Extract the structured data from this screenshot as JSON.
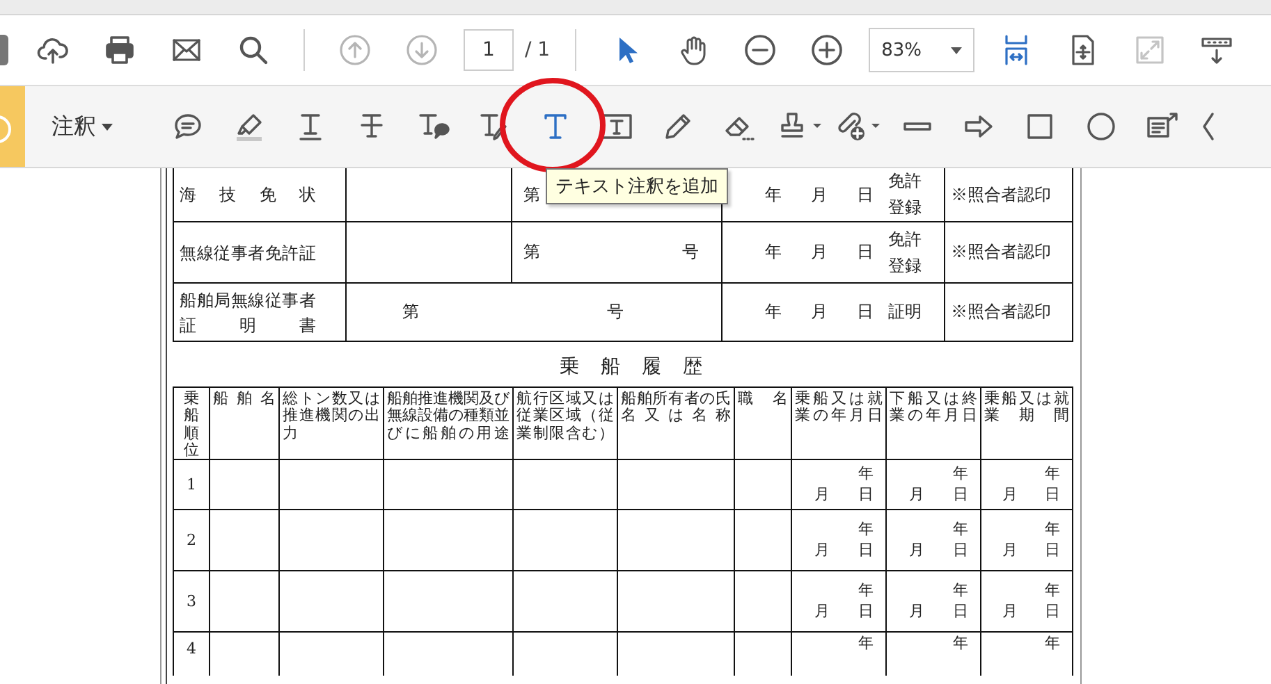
{
  "main_toolbar": {
    "nav_buttons": [
      {
        "disabled": true
      },
      {
        "disabled": true
      }
    ],
    "page_field": {
      "value": "1"
    },
    "page_total": "/ 1",
    "tools": [
      {
        "selected": true
      },
      {
        "selected": false
      }
    ],
    "zoom": {
      "value": "83%"
    },
    "view_buttons": [
      {
        "disabled": false
      },
      {
        "disabled": false
      },
      {
        "disabled": true
      },
      {
        "disabled": false
      }
    ]
  },
  "annotation_toolbar": {
    "label": "注釈",
    "tools": [
      {
        "selected": false
      },
      {
        "selected": false
      },
      {
        "selected": false
      },
      {
        "selected": false
      },
      {
        "selected": false
      },
      {
        "selected": false
      },
      {
        "selected": true
      },
      {
        "selected": false
      },
      {
        "selected": false
      },
      {
        "selected": false
      },
      {
        "selected": false
      },
      {
        "selected": false
      },
      {
        "selected": false
      },
      {
        "selected": false
      },
      {
        "selected": false
      },
      {
        "selected": false
      },
      {
        "selected": false
      },
      {
        "selected": false
      }
    ]
  },
  "tooltip": "テキスト注釈を追加",
  "licenses": [
    {
      "kind": "split",
      "name": "海技免状",
      "number": "第",
      "date": [
        "年",
        "月",
        "日"
      ],
      "note": "免許登録",
      "seal": "※照合者認印"
    },
    {
      "kind": "split",
      "name": "無線従事者免許証",
      "number": "第",
      "number_end": "号",
      "date": [
        "年",
        "月",
        "日"
      ],
      "note": "免許登録",
      "seal": "※照合者認印"
    },
    {
      "kind": "wide",
      "name": "船舶局無線従事者証明書",
      "number": "第",
      "number_end": "号",
      "date": [
        "年",
        "月",
        "日"
      ],
      "note": "証明",
      "seal": "※照合者認印"
    }
  ],
  "history": {
    "title": "乗船履歴",
    "columns": [
      {
        "kind": "vertical",
        "label": "乗船順位"
      },
      {
        "kind": "plain",
        "label": "船舶名"
      },
      {
        "kind": "plain",
        "label": "総トン数又は推進機関の出力"
      },
      {
        "kind": "plain",
        "label": "船舶推進機関及び無線設備の種類並びに船舶の用途"
      },
      {
        "kind": "plain",
        "label": "航行区域又は従業区域（従業制限含む）"
      },
      {
        "kind": "plain",
        "label": "船舶所有者の氏名又は名称"
      },
      {
        "kind": "plain",
        "label": "職名"
      },
      {
        "kind": "plain",
        "label": "乗船又は就業の年月日"
      },
      {
        "kind": "plain",
        "label": "下船又は終業の年月日"
      },
      {
        "kind": "plain",
        "label": "乗船又は就業期間"
      }
    ],
    "rows": [
      {
        "number": "1",
        "dates": [
          {
            "year": "年",
            "month": "月",
            "day": "日"
          },
          {
            "year": "年",
            "month": "月",
            "day": "日"
          },
          {
            "year": "年",
            "month": "月",
            "day": "日"
          }
        ]
      },
      {
        "number": "2",
        "dates": [
          {
            "year": "年",
            "month": "月",
            "day": "日"
          },
          {
            "year": "年",
            "month": "月",
            "day": "日"
          },
          {
            "year": "年",
            "month": "月",
            "day": "日"
          }
        ]
      },
      {
        "number": "3",
        "dates": [
          {
            "year": "年",
            "month": "月",
            "day": "日"
          },
          {
            "year": "年",
            "month": "月",
            "day": "日"
          },
          {
            "year": "年",
            "month": "月",
            "day": "日"
          }
        ]
      },
      {
        "number": "4",
        "dates": [
          {
            "year": "年"
          },
          {
            "year": "年"
          },
          {
            "year": "年"
          }
        ]
      }
    ]
  }
}
